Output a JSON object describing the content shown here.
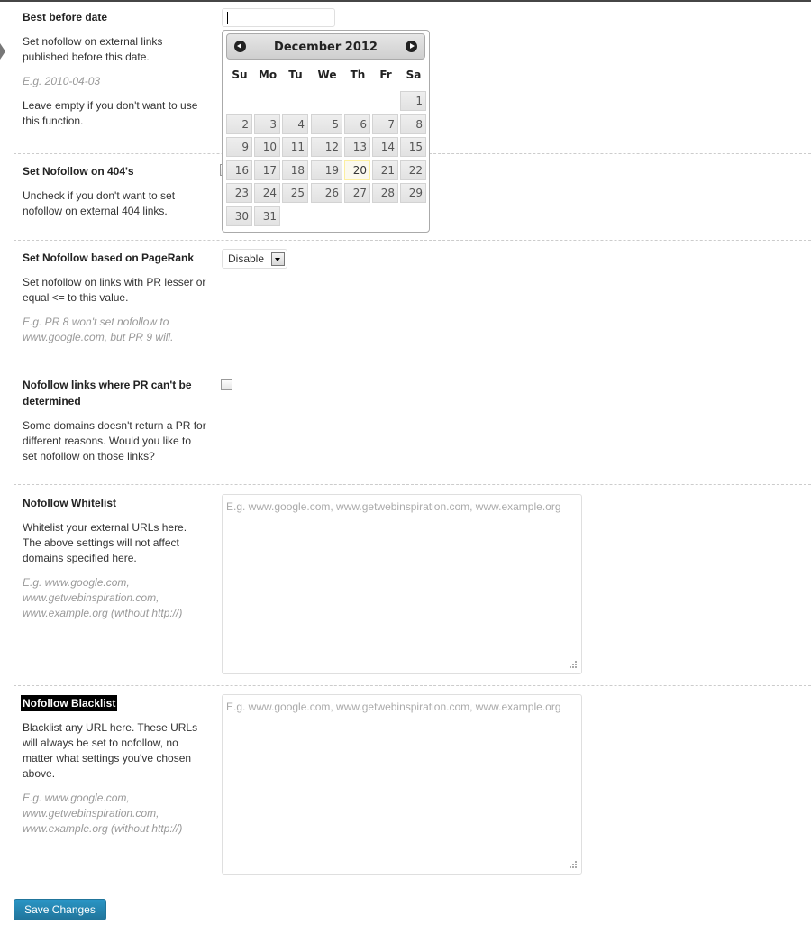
{
  "fields": {
    "best_before": {
      "title": "Best before date",
      "description": "Set nofollow on external links published before this date.",
      "example": "E.g. 2010-04-03",
      "note": "Leave empty if you don't want to use this function.",
      "value": ""
    },
    "nofollow_404": {
      "title": "Set Nofollow on 404's",
      "description": "Uncheck if you don't want to set nofollow on external 404 links."
    },
    "pagerank": {
      "title": "Set Nofollow based on PageRank",
      "description": "Set nofollow on links with PR lesser or equal <= to this value.",
      "example": "E.g. PR 8 won't set nofollow to www.google.com, but PR 9 will.",
      "selected": "Disable"
    },
    "pr_undetermined": {
      "title": "Nofollow links where PR can't be determined",
      "description": "Some domains doesn't return a PR for different reasons. Would you like to set nofollow on those links?",
      "checked": false
    },
    "whitelist": {
      "title": "Nofollow Whitelist",
      "description": "Whitelist your external URLs here. The above settings will not affect domains specified here.",
      "example": "E.g. www.google.com, www.getwebinspiration.com, www.example.org (without http://)",
      "placeholder": "E.g. www.google.com, www.getwebinspiration.com, www.example.org"
    },
    "blacklist": {
      "title": "Nofollow Blacklist",
      "description": "Blacklist any URL here. These URLs will always be set to nofollow, no matter what settings you've chosen above.",
      "example": "E.g. www.google.com, www.getwebinspiration.com, www.example.org (without http://)",
      "placeholder": "E.g. www.google.com, www.getwebinspiration.com, www.example.org"
    }
  },
  "datepicker": {
    "month_label": "December 2012",
    "prev_icon": "circle-triangle-left-icon",
    "next_icon": "circle-triangle-right-icon",
    "weekdays": [
      "Su",
      "Mo",
      "Tu",
      "We",
      "Th",
      "Fr",
      "Sa"
    ],
    "first_weekday_index": 6,
    "days_in_month": 31,
    "today": 20
  },
  "save_button": {
    "label": "Save Changes",
    "color": "#21759b"
  }
}
